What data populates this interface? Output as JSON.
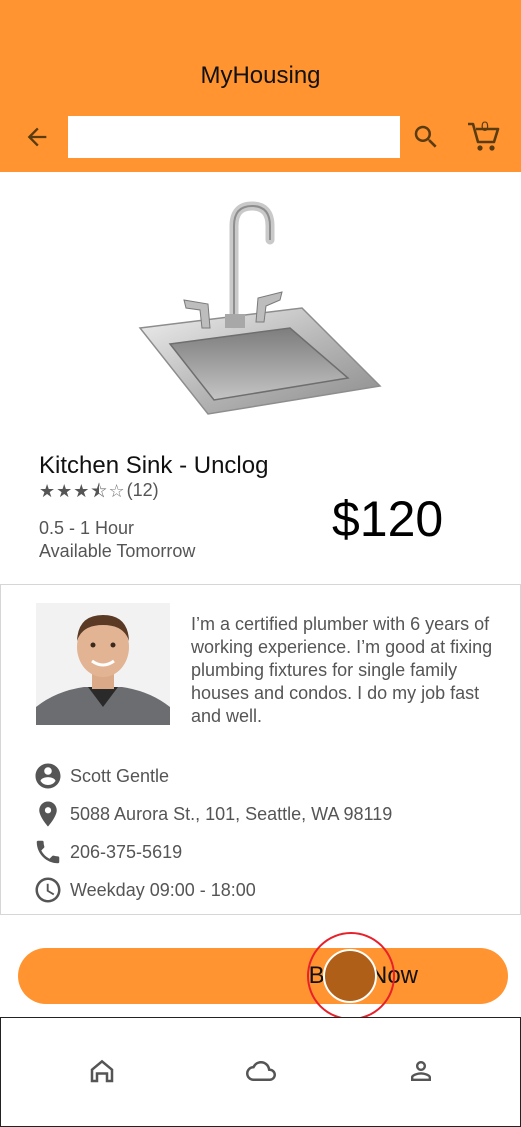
{
  "header": {
    "title": "MyHousing",
    "search_placeholder": "",
    "cart_count": "0",
    "back_icon": "arrow-left-icon",
    "search_icon": "search-icon",
    "cart_icon": "cart-icon"
  },
  "product": {
    "title": "Kitchen Sink - Unclog",
    "rating_stars": 3.5,
    "review_count": "(12)",
    "duration": "0.5 - 1 Hour",
    "availability": "Available Tomorrow",
    "price": "$120"
  },
  "provider": {
    "bio": "I’m a certified plumber with 6 years of working experience. I’m good at fixing plumbing fixtures for single family houses and condos. I do my job fast and well.",
    "name": "Scott Gentle",
    "address": "5088 Aurora St., 101, Seattle, WA 98119",
    "phone": "206-375-5619",
    "hours": "Weekday 09:00 - 18:00"
  },
  "actions": {
    "book_label": "Book Now"
  },
  "bottom_nav": {
    "items": [
      "home-icon",
      "cloud-icon",
      "person-icon"
    ]
  },
  "colors": {
    "accent": "#ff9430",
    "text_secondary": "#555555"
  }
}
